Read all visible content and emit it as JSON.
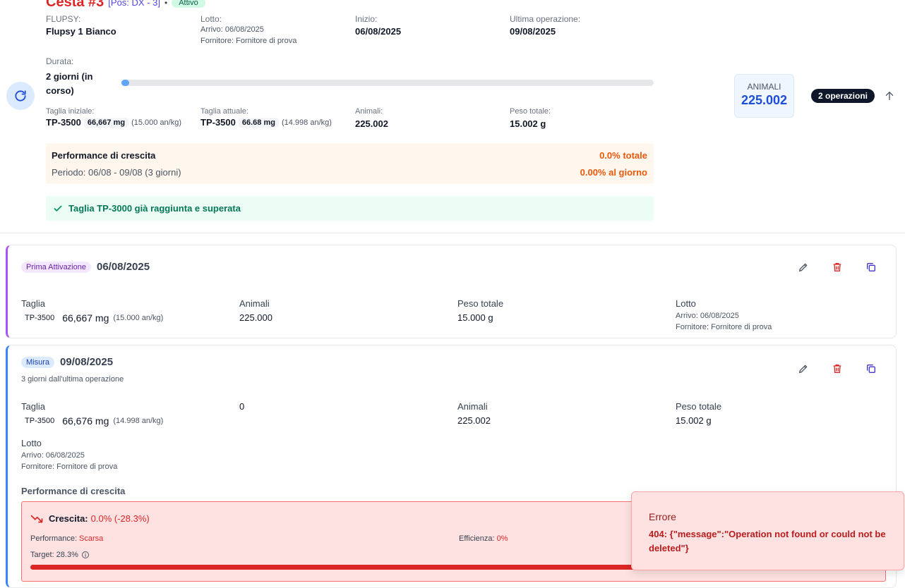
{
  "header": {
    "title": "Cesta #3",
    "position": "[Pos: DX - 3]",
    "dot": "•",
    "status": "Attivo",
    "flupsy_label": "FLUPSY:",
    "flupsy_value": "Flupsy 1 Bianco",
    "lotto_label": "Lotto:",
    "lotto_arrivo": "Arrivo: 06/08/2025",
    "lotto_fornitore": "Fornitore: Fornitore di prova",
    "inizio_label": "Inizio:",
    "inizio_value": "06/08/2025",
    "ultima_label": "Ultima operazione:",
    "ultima_value": "09/08/2025",
    "durata_label": "Durata:",
    "durata_value": "2 giorni (in corso)",
    "durata_progress": 0.01,
    "taglia_iniziale_label": "Taglia iniziale:",
    "taglia_iniziale_code": "TP-3500",
    "taglia_iniziale_mg": "66,667 mg",
    "taglia_iniziale_ankg": "(15.000 an/kg)",
    "taglia_attuale_label": "Taglia attuale:",
    "taglia_attuale_code": "TP-3500",
    "taglia_attuale_mg": "66.68 mg",
    "taglia_attuale_ankg": "(14.998 an/kg)",
    "animali_label": "Animali:",
    "animali_value": "225.002",
    "peso_label": "Peso totale:",
    "peso_value": "15.002 g",
    "perf_title": "Performance di crescita",
    "perf_total": "0.0% totale",
    "perf_period": "Periodo: 06/08 - 09/08 (3 giorni)",
    "perf_daily": "0.00% al giorno",
    "target_msg": "Taglia TP-3000 già raggiunta e superata",
    "animali_box_label": "ANIMALI",
    "animali_box_value": "225.002",
    "operations_badge": "2 operazioni"
  },
  "operations": [
    {
      "type": "Prima Attivazione",
      "date": "06/08/2025",
      "taglia_label": "Taglia",
      "taglia_code": "TP-3500",
      "taglia_mg": "66,667 mg",
      "taglia_ankg": "(15.000 an/kg)",
      "animali_label": "Animali",
      "animali_value": "225.000",
      "peso_label": "Peso totale",
      "peso_value": "15.000 g",
      "lotto_label": "Lotto",
      "lotto_arrivo": "Arrivo: 06/08/2025",
      "lotto_fornitore": "Fornitore: Fornitore di prova"
    },
    {
      "type": "Misura",
      "date": "09/08/2025",
      "since": "3 giorni dall'ultima operazione",
      "taglia_label": "Taglia",
      "taglia_code": "TP-3500",
      "taglia_mg": "66,676 mg",
      "taglia_ankg": "(14.998 an/kg)",
      "extra_value": "0",
      "animali_label": "Animali",
      "animali_value": "225.002",
      "peso_label": "Peso totale",
      "peso_value": "15.002 g",
      "lotto_label": "Lotto",
      "lotto_arrivo": "Arrivo: 06/08/2025",
      "lotto_fornitore": "Fornitore: Fornitore di prova",
      "perf_title": "Performance di crescita",
      "crescita_label": "Crescita:",
      "crescita_value": "0.0% (-28.3%)",
      "performance_label": "Performance:",
      "performance_value": "Scarsa",
      "efficienza_label": "Efficienza:",
      "efficienza_value": "0%",
      "target_label": "Target: 28.3%"
    }
  ],
  "toast": {
    "title": "Errore",
    "message": "404: {\"message\":\"Operation not found or could not be deleted\"}"
  },
  "colors": {
    "accent_red": "#dc2626",
    "accent_blue": "#1d4ed8",
    "purple_border": "#a855f7",
    "blue_border": "#3b82f6",
    "orange": "#ea580c",
    "green": "#047857"
  }
}
